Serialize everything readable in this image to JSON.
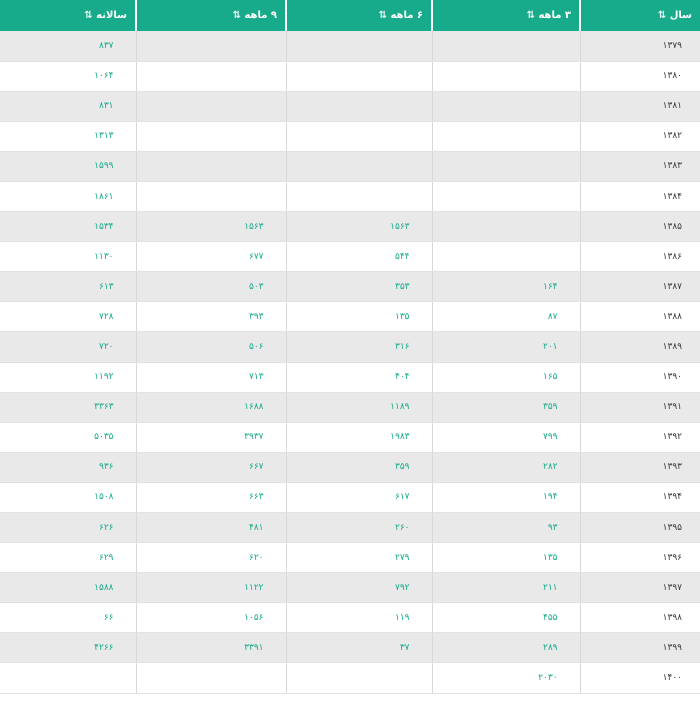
{
  "headers": {
    "year": "سال",
    "three_month": "۳ ماهه",
    "six_month": "۶ ماهه",
    "nine_month": "۹ ماهه",
    "annual": "سالانه",
    "sort_glyph": "⇅"
  },
  "colors": {
    "header_bg": "#17ab8b",
    "value_text": "#17ab8b",
    "stripe": "#e9e9e9"
  },
  "rows": [
    {
      "year": "۱۳۷۹",
      "m3": "",
      "m6": "",
      "m9": "",
      "annual": "۸۳۷"
    },
    {
      "year": "۱۳۸۰",
      "m3": "",
      "m6": "",
      "m9": "",
      "annual": "۱۰۶۴"
    },
    {
      "year": "۱۳۸۱",
      "m3": "",
      "m6": "",
      "m9": "",
      "annual": "۸۳۱"
    },
    {
      "year": "۱۳۸۲",
      "m3": "",
      "m6": "",
      "m9": "",
      "annual": "۱۳۱۳"
    },
    {
      "year": "۱۳۸۳",
      "m3": "",
      "m6": "",
      "m9": "",
      "annual": "۱۵۹۹"
    },
    {
      "year": "۱۳۸۴",
      "m3": "",
      "m6": "",
      "m9": "",
      "annual": "۱۸۶۱"
    },
    {
      "year": "۱۳۸۵",
      "m3": "",
      "m6": "۱۵۶۳",
      "m9": "۱۵۶۳",
      "annual": "۱۵۳۴"
    },
    {
      "year": "۱۳۸۶",
      "m3": "",
      "m6": "۵۴۴",
      "m9": "۶۷۷",
      "annual": "۱۱۳۰"
    },
    {
      "year": "۱۳۸۷",
      "m3": "۱۶۴",
      "m6": "۳۵۳",
      "m9": "۵۰۳",
      "annual": "۶۱۳"
    },
    {
      "year": "۱۳۸۸",
      "m3": "۸۷",
      "m6": "۱۳۵",
      "m9": "۳۹۳",
      "annual": "۷۲۸"
    },
    {
      "year": "۱۳۸۹",
      "m3": "۲۰۱",
      "m6": "۳۱۶",
      "m9": "۵۰۶",
      "annual": "۷۲۰"
    },
    {
      "year": "۱۳۹۰",
      "m3": "۱۶۵",
      "m6": "۴۰۴",
      "m9": "۷۱۳",
      "annual": "۱۱۹۲"
    },
    {
      "year": "۱۳۹۱",
      "m3": "۳۵۹",
      "m6": "۱۱۸۹",
      "m9": "۱۶۸۸",
      "annual": "۳۳۶۳"
    },
    {
      "year": "۱۳۹۲",
      "m3": "۷۹۹",
      "m6": "۱۹۸۳",
      "m9": "۳۹۳۷",
      "annual": "۵۰۳۵"
    },
    {
      "year": "۱۳۹۳",
      "m3": "۲۸۲",
      "m6": "۳۵۹",
      "m9": "۶۶۷",
      "annual": "۹۳۶"
    },
    {
      "year": "۱۳۹۴",
      "m3": "۱۹۴",
      "m6": "۶۱۷",
      "m9": "۶۶۳",
      "annual": "۱۵۰۸"
    },
    {
      "year": "۱۳۹۵",
      "m3": "۹۳",
      "m6": "۲۶۰",
      "m9": "۴۸۱",
      "annual": "۶۲۶"
    },
    {
      "year": "۱۳۹۶",
      "m3": "۱۳۵",
      "m6": "۲۷۹",
      "m9": "۶۲۰",
      "annual": "۶۲۹"
    },
    {
      "year": "۱۳۹۷",
      "m3": "۲۱۱",
      "m6": "۷۹۲",
      "m9": "۱۱۲۲",
      "annual": "۱۵۸۸"
    },
    {
      "year": "۱۳۹۸",
      "m3": "۴۵۵",
      "m6": "۱۱۹",
      "m9": "۱۰۵۶",
      "annual": "۶۶"
    },
    {
      "year": "۱۳۹۹",
      "m3": "۲۸۹",
      "m6": "۳۷",
      "m9": "۳۳۹۱",
      "annual": "۴۲۶۶"
    },
    {
      "year": "۱۴۰۰",
      "m3": "۲۰۳۰",
      "m6": "",
      "m9": "",
      "annual": ""
    }
  ]
}
